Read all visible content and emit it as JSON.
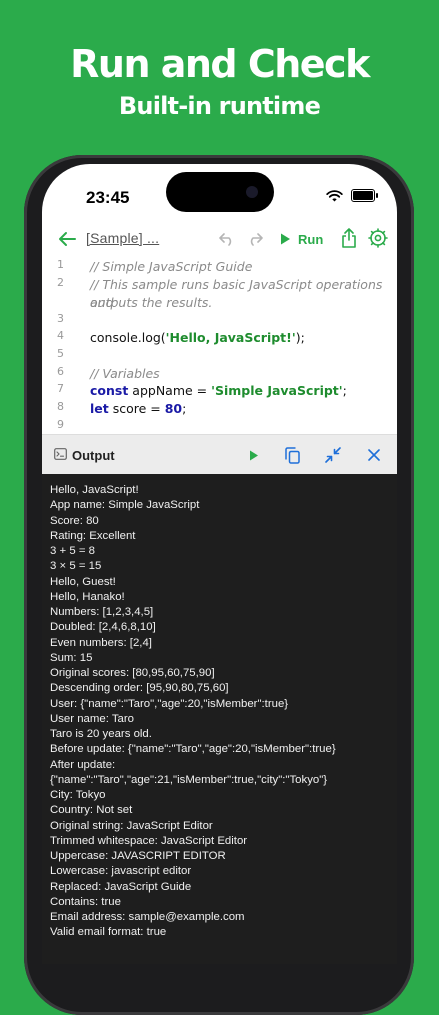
{
  "promo": {
    "headline": "Run and Check",
    "subheadline": "Built-in runtime"
  },
  "status_bar": {
    "time": "23:45"
  },
  "toolbar": {
    "title": "[Sample] ...",
    "run_label": "Run"
  },
  "editor": {
    "lines": [
      {
        "n": "1",
        "parts": [
          {
            "t": "// Simple JavaScript Guide",
            "c": "cmt"
          }
        ]
      },
      {
        "n": "2",
        "parts": [
          {
            "t": "// This sample runs basic JavaScript operations and",
            "c": "cmt"
          }
        ]
      },
      {
        "n": "",
        "parts": [
          {
            "t": "outputs the results.",
            "c": "cmt"
          }
        ]
      },
      {
        "n": "3",
        "parts": []
      },
      {
        "n": "4",
        "parts": [
          {
            "t": "console.log(",
            "c": "plain"
          },
          {
            "t": "'Hello, JavaScript!'",
            "c": "str"
          },
          {
            "t": ");",
            "c": "plain"
          }
        ]
      },
      {
        "n": "5",
        "parts": []
      },
      {
        "n": "6",
        "parts": [
          {
            "t": "// Variables",
            "c": "cmt"
          }
        ]
      },
      {
        "n": "7",
        "parts": [
          {
            "t": "const",
            "c": "kw"
          },
          {
            "t": " appName = ",
            "c": "plain"
          },
          {
            "t": "'Simple JavaScript'",
            "c": "str"
          },
          {
            "t": ";",
            "c": "plain"
          }
        ]
      },
      {
        "n": "8",
        "parts": [
          {
            "t": "let",
            "c": "kw"
          },
          {
            "t": " score = ",
            "c": "plain"
          },
          {
            "t": "80",
            "c": "num"
          },
          {
            "t": ";",
            "c": "plain"
          }
        ]
      },
      {
        "n": "9",
        "parts": []
      }
    ]
  },
  "output": {
    "title": "Output",
    "lines": [
      "Hello, JavaScript!",
      "App name: Simple JavaScript",
      "Score: 80",
      "Rating: Excellent",
      "3 + 5 = 8",
      "3 × 5 = 15",
      "Hello, Guest!",
      "Hello, Hanako!",
      "Numbers: [1,2,3,4,5]",
      "Doubled: [2,4,6,8,10]",
      "Even numbers: [2,4]",
      "Sum: 15",
      "Original scores: [80,95,60,75,90]",
      "Descending order: [95,90,80,75,60]",
      "User: {\"name\":\"Taro\",\"age\":20,\"isMember\":true}",
      "User name: Taro",
      "Taro is 20 years old.",
      "Before update: {\"name\":\"Taro\",\"age\":20,\"isMember\":true}",
      "After update:",
      "{\"name\":\"Taro\",\"age\":21,\"isMember\":true,\"city\":\"Tokyo\"}",
      "City: Tokyo",
      "Country: Not set",
      "Original string:  JavaScript Editor",
      "Trimmed whitespace: JavaScript Editor",
      "Uppercase:  JAVASCRIPT EDITOR",
      "Lowercase:  javascript editor",
      "Replaced:  JavaScript Guide",
      "Contains: true",
      "Email address: sample@example.com",
      "Valid email format: true"
    ]
  },
  "colors": {
    "accent": "#2bab4b",
    "blue_action": "#1e6fd9",
    "console_bg": "#1e1e1e"
  }
}
